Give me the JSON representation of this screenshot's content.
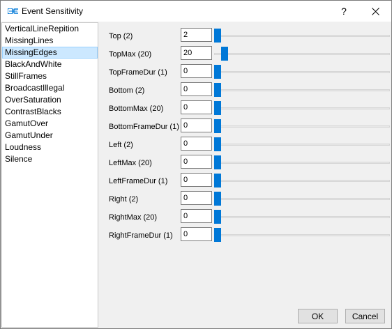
{
  "window": {
    "title": "Event Sensitivity",
    "help_glyph": "?",
    "close_glyph": "✕"
  },
  "sidebar": {
    "selected_index": 2,
    "items": [
      {
        "label": "VerticalLineRepition"
      },
      {
        "label": "MissingLines"
      },
      {
        "label": "MissingEdges"
      },
      {
        "label": "BlackAndWhite"
      },
      {
        "label": "StillFrames"
      },
      {
        "label": "BroadcastIllegal"
      },
      {
        "label": "OverSaturation"
      },
      {
        "label": "ContrastBlacks"
      },
      {
        "label": "GamutOver"
      },
      {
        "label": "GamutUnder"
      },
      {
        "label": "Loudness"
      },
      {
        "label": "Silence"
      }
    ]
  },
  "params": [
    {
      "label": "Top (2)",
      "value": "2",
      "slider_fraction": 0.0
    },
    {
      "label": "TopMax (20)",
      "value": "20",
      "slider_fraction": 0.04
    },
    {
      "label": "TopFrameDur (1)",
      "value": "0",
      "slider_fraction": 0.0
    },
    {
      "label": "Bottom (2)",
      "value": "0",
      "slider_fraction": 0.0
    },
    {
      "label": "BottomMax (20)",
      "value": "0",
      "slider_fraction": 0.0
    },
    {
      "label": "BottomFrameDur (1)",
      "value": "0",
      "slider_fraction": 0.0
    },
    {
      "label": "Left (2)",
      "value": "0",
      "slider_fraction": 0.0
    },
    {
      "label": "LeftMax (20)",
      "value": "0",
      "slider_fraction": 0.0
    },
    {
      "label": "LeftFrameDur (1)",
      "value": "0",
      "slider_fraction": 0.0
    },
    {
      "label": "Right (2)",
      "value": "0",
      "slider_fraction": 0.0
    },
    {
      "label": "RightMax (20)",
      "value": "0",
      "slider_fraction": 0.0
    },
    {
      "label": "RightFrameDur (1)",
      "value": "0",
      "slider_fraction": 0.0
    }
  ],
  "buttons": {
    "ok_label": "OK",
    "cancel_label": "Cancel"
  },
  "colors": {
    "accent": "#0078d7",
    "selection_bg": "#cce8ff"
  }
}
